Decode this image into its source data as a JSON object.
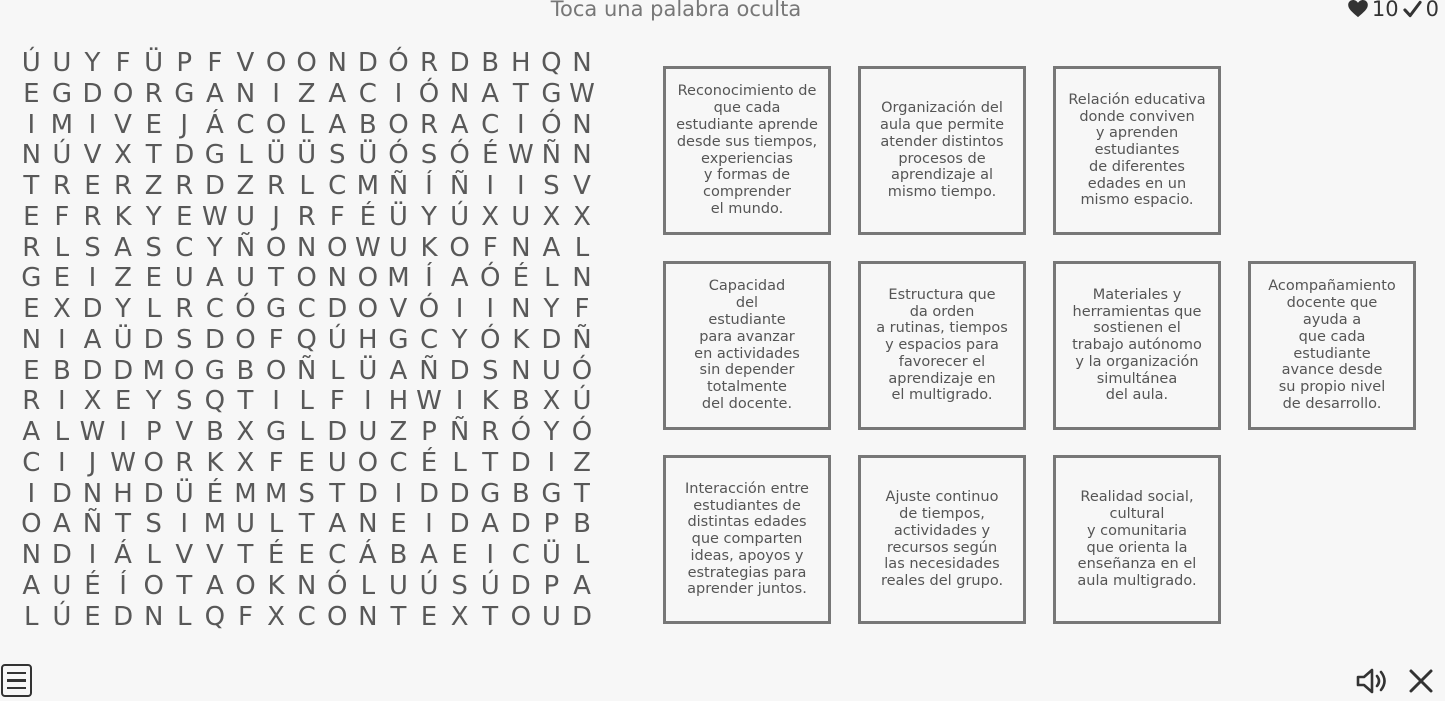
{
  "header": {
    "instruction": "Toca una palabra oculta"
  },
  "stats": {
    "lives": "10",
    "found": "0",
    "lives_icon": "heart-icon",
    "found_icon": "check-icon"
  },
  "grid": [
    [
      "Ú",
      "U",
      "Y",
      "F",
      "Ü",
      "P",
      "F",
      "V",
      "O",
      "O",
      "N",
      "D",
      "Ó",
      "R",
      "D",
      "B",
      "H",
      "Q",
      "N"
    ],
    [
      "E",
      "G",
      "D",
      "O",
      "R",
      "G",
      "A",
      "N",
      "I",
      "Z",
      "A",
      "C",
      "I",
      "Ó",
      "N",
      "A",
      "T",
      "G",
      "W"
    ],
    [
      "I",
      "M",
      "I",
      "V",
      "E",
      "J",
      "Á",
      "C",
      "O",
      "L",
      "A",
      "B",
      "O",
      "R",
      "A",
      "C",
      "I",
      "Ó",
      "N"
    ],
    [
      "N",
      "Ú",
      "V",
      "X",
      "T",
      "D",
      "G",
      "L",
      "Ü",
      "Ü",
      "S",
      "Ü",
      "Ó",
      "S",
      "Ó",
      "É",
      "W",
      "Ñ",
      "N"
    ],
    [
      "T",
      "R",
      "E",
      "R",
      "Z",
      "R",
      "D",
      "Z",
      "R",
      "L",
      "C",
      "M",
      "Ñ",
      "Í",
      "Ñ",
      "I",
      "I",
      "S",
      "V"
    ],
    [
      "E",
      "F",
      "R",
      "K",
      "Y",
      "E",
      "W",
      "U",
      "J",
      "R",
      "F",
      "É",
      "Ü",
      "Y",
      "Ú",
      "X",
      "U",
      "X",
      "X"
    ],
    [
      "R",
      "L",
      "S",
      "A",
      "S",
      "C",
      "Y",
      "Ñ",
      "O",
      "N",
      "O",
      "W",
      "U",
      "K",
      "O",
      "F",
      "N",
      "A",
      "L"
    ],
    [
      "G",
      "E",
      "I",
      "Z",
      "E",
      "U",
      "A",
      "U",
      "T",
      "O",
      "N",
      "O",
      "M",
      "Í",
      "A",
      "Ó",
      "É",
      "L",
      "N"
    ],
    [
      "E",
      "X",
      "D",
      "Y",
      "L",
      "R",
      "C",
      "Ó",
      "G",
      "C",
      "D",
      "O",
      "V",
      "Ó",
      "I",
      "I",
      "N",
      "Y",
      "F"
    ],
    [
      "N",
      "I",
      "A",
      "Ü",
      "D",
      "S",
      "D",
      "O",
      "F",
      "Q",
      "Ú",
      "H",
      "G",
      "C",
      "Y",
      "Ó",
      "K",
      "D",
      "Ñ"
    ],
    [
      "E",
      "B",
      "D",
      "D",
      "M",
      "O",
      "G",
      "B",
      "O",
      "Ñ",
      "L",
      "Ü",
      "A",
      "Ñ",
      "D",
      "S",
      "N",
      "U",
      "Ó"
    ],
    [
      "R",
      "I",
      "X",
      "E",
      "Y",
      "S",
      "Q",
      "T",
      "I",
      "L",
      "F",
      "I",
      "H",
      "W",
      "I",
      "K",
      "B",
      "X",
      "Ú"
    ],
    [
      "A",
      "L",
      "W",
      "I",
      "P",
      "V",
      "B",
      "X",
      "G",
      "L",
      "D",
      "U",
      "Z",
      "P",
      "Ñ",
      "R",
      "Ó",
      "Y",
      "Ó"
    ],
    [
      "C",
      "I",
      "J",
      "W",
      "O",
      "R",
      "K",
      "X",
      "F",
      "E",
      "U",
      "O",
      "C",
      "É",
      "L",
      "T",
      "D",
      "I",
      "Z"
    ],
    [
      "I",
      "D",
      "N",
      "H",
      "D",
      "Ü",
      "É",
      "M",
      "M",
      "S",
      "T",
      "D",
      "I",
      "D",
      "D",
      "G",
      "B",
      "G",
      "T"
    ],
    [
      "O",
      "A",
      "Ñ",
      "T",
      "S",
      "I",
      "M",
      "U",
      "L",
      "T",
      "A",
      "N",
      "E",
      "I",
      "D",
      "A",
      "D",
      "P",
      "B"
    ],
    [
      "N",
      "D",
      "I",
      "Á",
      "L",
      "V",
      "V",
      "T",
      "É",
      "E",
      "C",
      "Á",
      "B",
      "A",
      "E",
      "I",
      "C",
      "Ü",
      "L"
    ],
    [
      "A",
      "U",
      "É",
      "Í",
      "O",
      "T",
      "A",
      "O",
      "K",
      "N",
      "Ó",
      "L",
      "U",
      "Ú",
      "S",
      "Ú",
      "D",
      "P",
      "A"
    ],
    [
      "L",
      "Ú",
      "E",
      "D",
      "N",
      "L",
      "Q",
      "F",
      "X",
      "C",
      "O",
      "N",
      "T",
      "E",
      "X",
      "T",
      "O",
      "U",
      "D"
    ]
  ],
  "cards": [
    "Reconocimiento de\nque cada\nestudiante aprende\ndesde sus tiempos,\nexperiencias\ny formas de\ncomprender\nel mundo.",
    "Organización del\naula que permite\natender distintos\nprocesos de\naprendizaje al\nmismo tiempo.",
    "Relación educativa\ndonde conviven\ny aprenden\nestudiantes\nde diferentes\nedades en un\nmismo espacio.",
    "Capacidad\ndel\nestudiante\npara avanzar\nen actividades\nsin depender\ntotalmente\ndel docente.",
    "Estructura que\nda orden\na rutinas, tiempos\ny espacios para\nfavorecer el\naprendizaje en\nel multigrado.",
    "Materiales y\nherramientas que\nsostienen el\ntrabajo autónomo\ny la organización\nsimultánea\ndel aula.",
    "Acompañamiento\ndocente que\nayuda a\nque cada\nestudiante\navance desde\nsu propio nivel\nde desarrollo.",
    "Interacción entre\nestudiantes de\ndistintas edades\nque comparten\nideas, apoyos y\nestrategias para\naprender juntos.",
    "Ajuste continuo\nde tiempos,\nactividades y\nrecursos según\nlas necesidades\nreales del grupo.",
    "Realidad social,\ncultural\ny comunitaria\nque orienta la\nenseñanza en el\naula multigrado."
  ],
  "footer": {
    "menu_icon": "menu-icon",
    "sound_icon": "speaker-icon",
    "close_icon": "close-icon"
  }
}
